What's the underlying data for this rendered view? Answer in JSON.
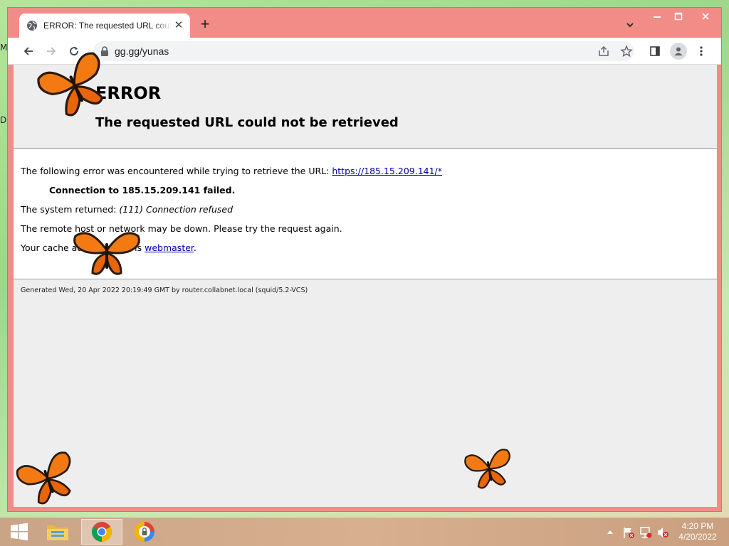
{
  "desktop": {
    "letters": [
      "M",
      "D"
    ]
  },
  "browser": {
    "tab": {
      "title": "ERROR: The requested URL could not be retrieved"
    },
    "address": {
      "url": "gg.gg/yunas"
    }
  },
  "page": {
    "title": "ERROR",
    "subtitle": "The requested URL could not be retrieved",
    "line1_prefix": "The following error was encountered while trying to retrieve the URL: ",
    "line1_link": "https://185.15.209.141/*",
    "line2": "Connection to 185.15.209.141 failed.",
    "line3_prefix": "The system returned: ",
    "line3_italic": "(111) Connection refused",
    "line4": "The remote host or network may be down. Please try the request again.",
    "line5_prefix": "Your cache administrator is ",
    "line5_link": "webmaster",
    "line5_suffix": ".",
    "footer": "Generated Wed, 20 Apr 2022 20:19:49 GMT by router.collabnet.local (squid/5.2-VCS)"
  },
  "taskbar": {
    "time": "4:20 PM",
    "date": "4/20/2022"
  },
  "colors": {
    "frame": "#f28c87",
    "link": "#0000aa",
    "page_bg": "#eeeeee"
  }
}
